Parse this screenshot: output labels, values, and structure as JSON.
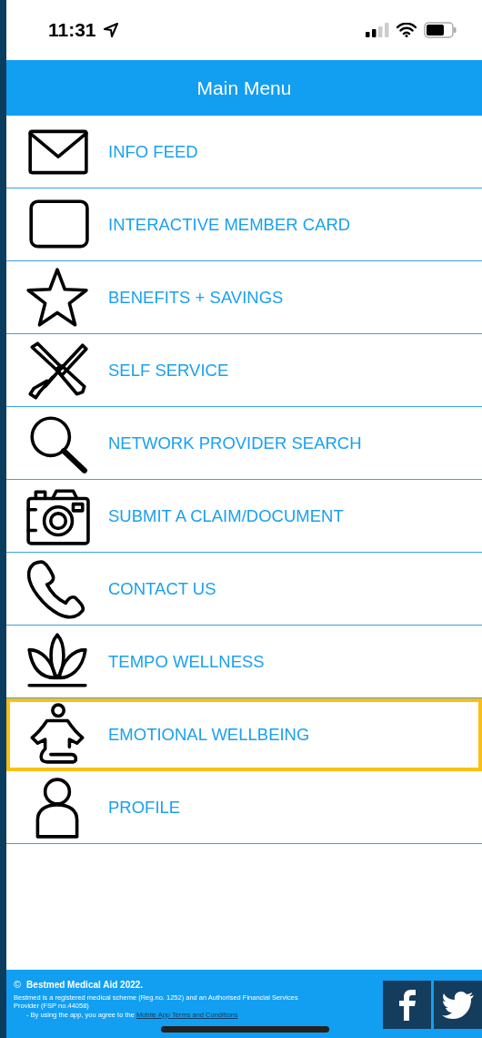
{
  "status_bar": {
    "time": "11:31"
  },
  "header": {
    "title": "Main Menu"
  },
  "menu": [
    {
      "kind": "mail",
      "label": "INFO FEED",
      "selected": false
    },
    {
      "kind": "card",
      "label": "INTERACTIVE MEMBER CARD",
      "selected": false
    },
    {
      "kind": "star",
      "label": "BENEFITS + SAVINGS",
      "selected": false
    },
    {
      "kind": "tools",
      "label": "SELF SERVICE",
      "selected": false
    },
    {
      "kind": "search",
      "label": "NETWORK PROVIDER SEARCH",
      "selected": false
    },
    {
      "kind": "camera",
      "label": "SUBMIT A CLAIM/DOCUMENT",
      "selected": false
    },
    {
      "kind": "phone",
      "label": "CONTACT US",
      "selected": false
    },
    {
      "kind": "lotus",
      "label": "TEMPO WELLNESS",
      "selected": false
    },
    {
      "kind": "meditation",
      "label": "EMOTIONAL WELLBEING",
      "selected": true
    },
    {
      "kind": "person",
      "label": "PROFILE",
      "selected": false
    }
  ],
  "footer": {
    "copyright_symbol": "©",
    "title": "Bestmed Medical Aid 2022.",
    "notice": "Bestmed is a registered medical scheme (Reg.no. 1252) and an Authorised Financial Services Provider (FSP no.44058)",
    "agreement": "- By using the app, you agree to the",
    "terms_link": "Mobile App Terms and Conditions"
  }
}
